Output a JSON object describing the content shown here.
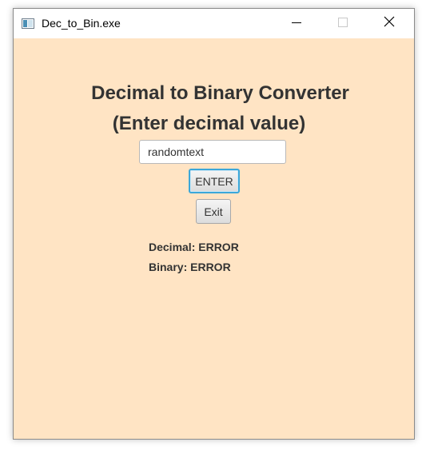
{
  "window": {
    "title": "Dec_to_Bin.exe",
    "background_color": "#ffe4c4",
    "controls": {
      "minimize_icon": "minimize-icon",
      "maximize_icon": "maximize-icon",
      "close_icon": "close-icon"
    }
  },
  "main": {
    "heading_line1": "Decimal to Binary Converter",
    "heading_line2": "(Enter decimal value)",
    "input_value": "randomtext",
    "enter_label": "ENTER",
    "exit_label": "Exit",
    "decimal_result": "Decimal: ERROR",
    "binary_result": "Binary: ERROR"
  },
  "colors": {
    "focus_border": "#3ba7d9",
    "text": "#333333"
  }
}
